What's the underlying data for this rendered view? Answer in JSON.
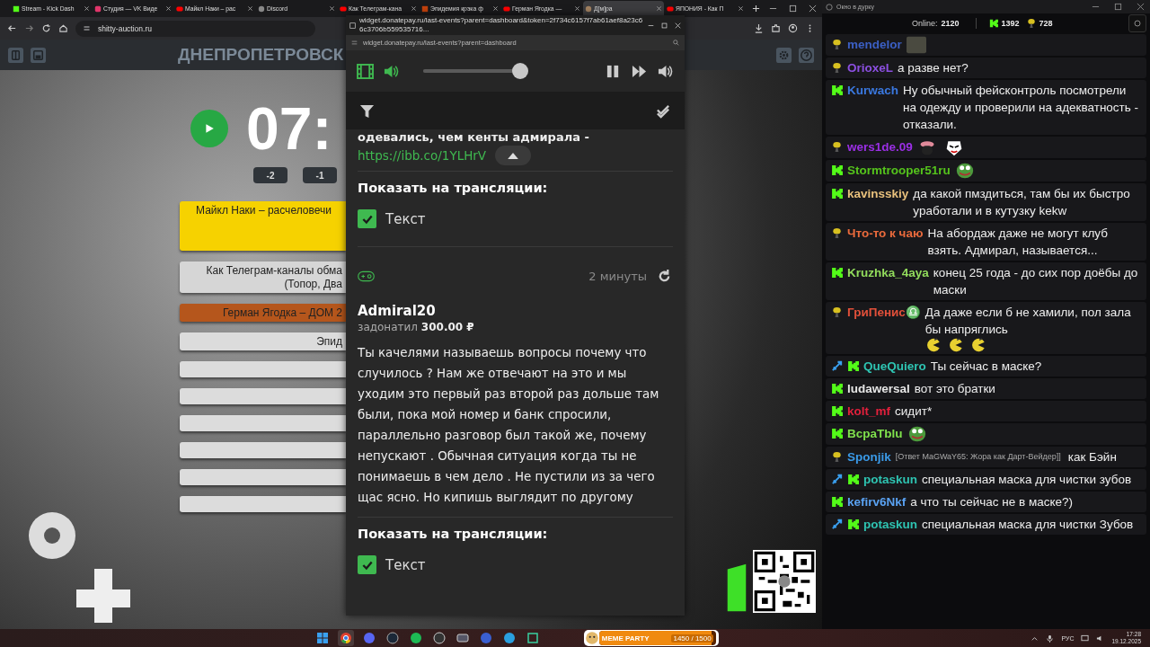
{
  "browser": {
    "tabs": [
      {
        "title": "Stream - Kick Dash",
        "kind": "kick",
        "selected": false
      },
      {
        "title": "Студия — VK Виде",
        "kind": "vk",
        "selected": false
      },
      {
        "title": "Майкл Наки – рас",
        "kind": "youtube",
        "selected": false
      },
      {
        "title": "Discord",
        "kind": "discord",
        "selected": false
      },
      {
        "title": "Как Телеграм-кана",
        "kind": "youtube",
        "selected": false
      },
      {
        "title": "Эпидемия крэка ф",
        "kind": "video",
        "selected": false
      },
      {
        "title": "Герман Ягодка —",
        "kind": "youtube",
        "selected": false
      },
      {
        "title": "Д[м]ра",
        "kind": "avatar",
        "selected": true
      },
      {
        "title": "ЯПОНИЯ - Как П",
        "kind": "youtube",
        "selected": false
      }
    ],
    "address": "shitty-auction.ru"
  },
  "page": {
    "title": "ДНЕПРОПЕТРОВСК",
    "timer": "07:",
    "adjust_buttons": [
      "-2",
      "-1"
    ],
    "lots": [
      {
        "lines": [
          "Майкл Наки – расчеловечи"
        ],
        "color": "#f6d200"
      },
      {
        "lines": [
          "Как Телеграм-каналы обма",
          "(Топор, Два"
        ],
        "color": "#d6d6d6"
      },
      {
        "lines": [
          "Герман Ягодка – ДОМ 2"
        ],
        "color": "#b5561c"
      },
      {
        "lines": [
          "Эпид"
        ],
        "color": "#dcdcdc"
      },
      {
        "color": "#dcdcdc"
      },
      {
        "color": "#dcdcdc"
      },
      {
        "color": "#dcdcdc"
      },
      {
        "color": "#dcdcdc"
      },
      {
        "color": "#dcdcdc"
      },
      {
        "color": "#dcdcdc"
      }
    ]
  },
  "popup": {
    "title": "widget.donatepay.ru/last-events?parent=dashboard&token=2f734c6157f7ab61aef8a23c66c3706b559535716...",
    "address": "widget.donatepay.ru/last-events?parent=dashboard",
    "volume": {
      "level": 1
    },
    "events": [
      {
        "text": "одевались, чем кенты адмирала -",
        "link": "https://ibb.co/1YLHrV",
        "show_label": "Показать на трансляции:",
        "option": {
          "label": "Текст",
          "checked": true
        }
      },
      {
        "time": "2 минуты",
        "name": "Admiral20",
        "action": "задонатил **300.00 ₽**",
        "text": "Ты качелями называешь вопросы почему что случилось ? Нам же отвечают на это и мы уходим это первый раз второй раз дольше там были, пока мой номер и банк спросили, параллельно разговор был такой же, почему непускают . Обычная ситуация когда ты не понимаешь в чем дело . Не пустили из за чего щас ясно. Но кипишь выглядит по другому",
        "show_label": "Показать на трансляции:",
        "option": {
          "label": "Текст",
          "checked": true
        }
      }
    ]
  },
  "chat": {
    "title": "Окно в дурку",
    "online_label": "Online:",
    "online": "2120",
    "kick_count": "1392",
    "other_count": "728",
    "messages": [
      {
        "kind": "other",
        "moderator": false,
        "user": "mendelor",
        "color": "#3b5fc4",
        "emotes": [
          {
            "kind": "photo"
          }
        ]
      },
      {
        "kind": "other",
        "moderator": false,
        "user": "OrioxeL",
        "color": "#8b4fe0",
        "text": "а разве нет?"
      },
      {
        "kind": "kick",
        "moderator": false,
        "user": "Kurwach",
        "color": "#3a78e0",
        "text": "Ну обычный фейсконтроль посмотрели на одежду и проверили на адекватность - отказали."
      },
      {
        "kind": "other",
        "moderator": false,
        "user": "wers1de.09",
        "color": "#9b2fe6",
        "emotes": [
          {
            "kind": "creature"
          },
          {
            "kind": "mask"
          }
        ]
      },
      {
        "kind": "kick",
        "moderator": false,
        "user": "Stormtrooper51ru",
        "color": "#55c41c",
        "emotes": [
          {
            "kind": "frog"
          }
        ]
      },
      {
        "kind": "kick",
        "moderator": false,
        "user": "kavinsskiy",
        "color": "#e8c07c",
        "text": "да какой пмздиться, там бы их быстро уработали и в кутузку kekw"
      },
      {
        "kind": "other",
        "moderator": false,
        "user": "Что-то к чаю",
        "color": "#ea6a3c",
        "text": "На абордаж даже не могут клуб взять. Адмирал, называется..."
      },
      {
        "kind": "kick",
        "moderator": false,
        "user": "Kruzhka_4aya",
        "color": "#92dc5c",
        "text": "конец 25 года - до сих пор доёбы до маски"
      },
      {
        "kind": "other",
        "moderator": false,
        "user": "ГриПенис♎",
        "color": "#e2503a",
        "text": "Да даже если б не хамили, пол зала бы напряглись",
        "emotes": [
          {
            "kind": "pacman"
          },
          {
            "kind": "pacman"
          },
          {
            "kind": "pacman"
          }
        ]
      },
      {
        "kind": "kick",
        "moderator": true,
        "user": "QueQuiero",
        "color": "#2ec4b2",
        "text": "Ты сейчас в маске?"
      },
      {
        "kind": "kick",
        "moderator": false,
        "user": "ludawersal",
        "color": "#e6e6e6",
        "text": "вот это братки"
      },
      {
        "kind": "kick",
        "moderator": false,
        "user": "kolt_mf",
        "color": "#e2203c",
        "text": "сидит*"
      },
      {
        "kind": "kick",
        "moderator": false,
        "user": "BcpaTblu",
        "color": "#7fe04c",
        "emotes": [
          {
            "kind": "frog"
          }
        ]
      },
      {
        "kind": "other",
        "moderator": false,
        "user": "Sponjik",
        "color": "#3a9ae8",
        "reply": "[Ответ MaGWaY65: Жора как Дарт-Вейдер]]",
        "text": "как Бэйн"
      },
      {
        "kind": "kick",
        "moderator": true,
        "user": "potaskun",
        "color": "#2ec4b2",
        "text": "специальная маска для чистки зубов"
      },
      {
        "kind": "kick",
        "moderator": false,
        "user": "kefirv6Nkf",
        "color": "#5aa2f2",
        "text": "а что ты сейчас не в маске?)"
      },
      {
        "kind": "kick",
        "moderator": true,
        "user": "potaskun",
        "color": "#2ec4b2",
        "text": "специальная маска для чистки Зубов"
      }
    ]
  },
  "taskbar": {
    "apps": [
      {
        "kind": "windows",
        "selected": false
      },
      {
        "kind": "chrome",
        "selected": true
      },
      {
        "kind": "discord",
        "selected": false
      },
      {
        "kind": "steam",
        "selected": false
      },
      {
        "kind": "spotify",
        "selected": false
      },
      {
        "kind": "obs",
        "selected": false
      },
      {
        "kind": "screen",
        "selected": false
      },
      {
        "kind": "media",
        "selected": false
      },
      {
        "kind": "telegram",
        "selected": false
      },
      {
        "kind": "snip",
        "selected": false
      }
    ],
    "widget": {
      "title": "MEME PARTY",
      "progress": "1450 / 1500",
      "level": 0.967
    },
    "language": "РУС",
    "time": "17:28",
    "date": "19.12.2025"
  }
}
